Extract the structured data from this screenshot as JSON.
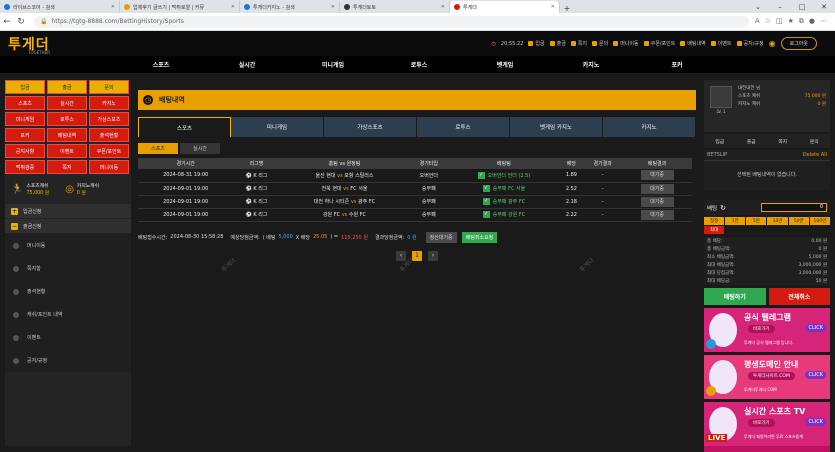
{
  "browser": {
    "tabs": [
      {
        "label": "라이브스코어 - 검색",
        "color": "#1a73e8"
      },
      {
        "label": "업체후기 글쓰기 | 먹튀로얄 | 커뮤",
        "color": "#e8a000"
      },
      {
        "label": "투게더카지노 - 검색",
        "color": "#1a73e8"
      },
      {
        "label": "투게더토토",
        "color": "#333333"
      },
      {
        "label": "투게더",
        "color": "#d41b0f",
        "active": true
      }
    ],
    "url": "https://tgtg-8888.com/BettingHistory/Sports"
  },
  "header": {
    "logo": "투게더",
    "logo_sub": "TOGETHER",
    "time": "20:55:22",
    "links": [
      "입금",
      "출금",
      "쪽지",
      "문의",
      "머니이동",
      "쿠폰/포인트",
      "배팅내역",
      "이벤트",
      "공지/규정"
    ],
    "logout": "로그아웃"
  },
  "mainnav": [
    "스포츠",
    "실시간",
    "미니게임",
    "로투스",
    "벳게임",
    "카지노",
    "포커"
  ],
  "leftmenu": {
    "grid": [
      {
        "label": "입금",
        "gold": true
      },
      {
        "label": "출금",
        "gold": true
      },
      {
        "label": "문의",
        "gold": true
      },
      {
        "label": "스포츠"
      },
      {
        "label": "실시간"
      },
      {
        "label": "카지노"
      },
      {
        "label": "미니게임"
      },
      {
        "label": "로투스"
      },
      {
        "label": "가상스포츠"
      },
      {
        "label": "포커"
      },
      {
        "label": "배팅내역"
      },
      {
        "label": "출석현황"
      },
      {
        "label": "공지사항"
      },
      {
        "label": "이벤트"
      },
      {
        "label": "쿠폰/포인트"
      },
      {
        "label": "먹튀검증"
      },
      {
        "label": "쪽지"
      },
      {
        "label": "머니이동"
      }
    ],
    "sports_cash_label": "스포츠캐쉬",
    "sports_cash_value": "75,000 원",
    "casino_cash_label": "카지노캐쉬",
    "casino_cash_value": "0 원",
    "deposit_section": "입금신청",
    "withdraw_section": "출금신청",
    "list": [
      "머니이동",
      "쪽지함",
      "출석현황",
      "캐쉬/포인트 내역",
      "이벤트",
      "공지/규정"
    ]
  },
  "betting": {
    "title": "배팅내역",
    "tabs": [
      "스포츠",
      "미니게임",
      "가상스포츠",
      "로투스",
      "벳게임 카지노",
      "카지노"
    ],
    "subtabs": [
      "스포츠",
      "실시간"
    ],
    "columns": [
      "경기시간",
      "리그명",
      "홈팀 vs 원정팀",
      "경기타입",
      "배팅팀",
      "배당",
      "경기결과",
      "배팅결과"
    ],
    "rows": [
      {
        "time": "2024-08-31 19:00",
        "league": "K 리그",
        "home": "울산 현대",
        "away": "포항 스틸러스",
        "type": "오버언더",
        "pick": "오버언더 언더 (2.5)",
        "odds": "1.89",
        "result": "-",
        "status": "대기중"
      },
      {
        "time": "2024-09-01 19:00",
        "league": "K 리그",
        "home": "전북 현대",
        "away": "FC 서울",
        "type": "승무패",
        "pick": "승무패 FC 서울",
        "odds": "2.52",
        "result": "-",
        "status": "대기중"
      },
      {
        "time": "2024-09-01 19:00",
        "league": "K 리그",
        "home": "대전 하나 시티즌",
        "away": "광주 FC",
        "type": "승무패",
        "pick": "승무패 광주 FC",
        "odds": "2.18",
        "result": "-",
        "status": "대기중"
      },
      {
        "time": "2024-09-01 19:00",
        "league": "K 리그",
        "home": "강원 FC",
        "away": "수원 FC",
        "type": "승무패",
        "pick": "승무패 강원 FC",
        "odds": "2.22",
        "result": "-",
        "status": "대기중"
      }
    ],
    "vs": "vs",
    "summary": {
      "bet_time_label": "배팅접수시간:",
      "bet_time": "2024-08-30 15:58:28",
      "expected_label": "예상당첨금액:",
      "formula_a": "( 배팅",
      "bet_amount": "5,000",
      "formula_b": "X 배당",
      "odds_total": "25.05",
      "formula_c": ") =",
      "expected": "115,250 원",
      "result_label": "결과당첨금액:",
      "result": "0 원",
      "status_btn": "정산대기중",
      "cancel_btn": "배팅취소요청"
    },
    "pager": {
      "prev": "‹",
      "current": "1",
      "next": "›"
    }
  },
  "account": {
    "level": "LV. 1",
    "nickname": "내전내전 님",
    "sports_label": "스포츠 캐쉬",
    "sports_value": "75,000 원",
    "casino_label": "카지노 캐쉬",
    "casino_value": "0 원",
    "buttons": [
      "입금",
      "출금",
      "쪽지",
      "문의"
    ]
  },
  "betslip": {
    "title": "BETSLIP",
    "delete_all": "Delete All",
    "empty": "선택된 배팅내역이 없습니다.",
    "bet_label": "배팅",
    "bet_value": "0",
    "chips": [
      "정정",
      "1만",
      "5만",
      "10만",
      "50만",
      "100만",
      "최대"
    ],
    "info": [
      {
        "label": "총 배당:",
        "value": "0.00 원"
      },
      {
        "label": "총 배팅금액:",
        "value": "0 원"
      },
      {
        "label": "최소 배팅금액:",
        "value": "5,000 원"
      },
      {
        "label": "최대 배팅금액:",
        "value": "3,000,000 원"
      },
      {
        "label": "최대 당첨금액:",
        "value": "3,000,000 원"
      },
      {
        "label": "최대 배당금:",
        "value": "50 원"
      }
    ],
    "bet_btn": "배팅하기",
    "cancel_btn": "전체취소"
  },
  "banners": [
    {
      "title": "공식 텔레그램",
      "sub": "바로가기",
      "cta": "CLICK",
      "foot": "투게더 공식 텔레그램 입니다."
    },
    {
      "title": "평생도메인 안내",
      "sub": "투게더사이트.COM",
      "cta": "CLICK",
      "foot": "투게더투게더.COM"
    },
    {
      "title": "실시간 스포츠 TV",
      "sub": "바로가기",
      "cta": "CLICK",
      "foot": "투게더 회원이라면 무료 스포츠중계",
      "live": "LIVE"
    }
  ],
  "watermark": "투게더"
}
